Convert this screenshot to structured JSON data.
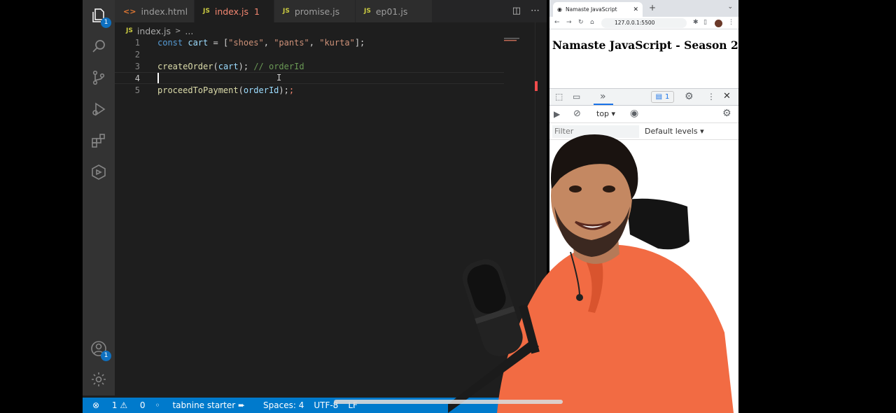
{
  "activity_bar": {
    "explorer_badge": "1",
    "account_badge": "1"
  },
  "tabs": [
    {
      "icon": "<>",
      "label": "index.html"
    },
    {
      "icon": "JS",
      "label": "index.js",
      "errors": "1"
    },
    {
      "icon": "JS",
      "label": "promise.js"
    },
    {
      "icon": "JS",
      "label": "ep01.js"
    }
  ],
  "breadcrumb": {
    "icon": "JS",
    "file": "index.js",
    "more": "..."
  },
  "editor": {
    "line_numbers": [
      "1",
      "2",
      "3",
      "4",
      "5"
    ],
    "line1": {
      "kw": "const",
      "var": "cart",
      "eq": " = [",
      "s1": "\"shoes\"",
      "s2": "\"pants\"",
      "s3": "\"kurta\"",
      "end": "];"
    },
    "line3": {
      "fn": "createOrder",
      "open": "(",
      "arg": "cart",
      "close": ");",
      "comment": "// orderId"
    },
    "line5": {
      "fn": "proceedToPayment",
      "open": "(",
      "arg": "orderId",
      "close": ");",
      "tail": ";"
    }
  },
  "status_bar": {
    "errors": "1",
    "warnings": "0",
    "tabnine": "tabnine starter",
    "spaces": "Spaces: 4",
    "encoding": "UTF-8",
    "eol": "LF"
  },
  "browser": {
    "tab_title": "Namaste JavaScript",
    "url": "127.0.0.1:5500",
    "heading": "Namaste JavaScript - Season 2"
  },
  "devtools": {
    "issues_count": "1",
    "context": "top",
    "filter_placeholder": "Filter",
    "levels": "Default levels"
  },
  "colors": {
    "status_bar": "#007acc",
    "editor_bg": "#1e1e1e",
    "shirt": "#f26b43"
  }
}
